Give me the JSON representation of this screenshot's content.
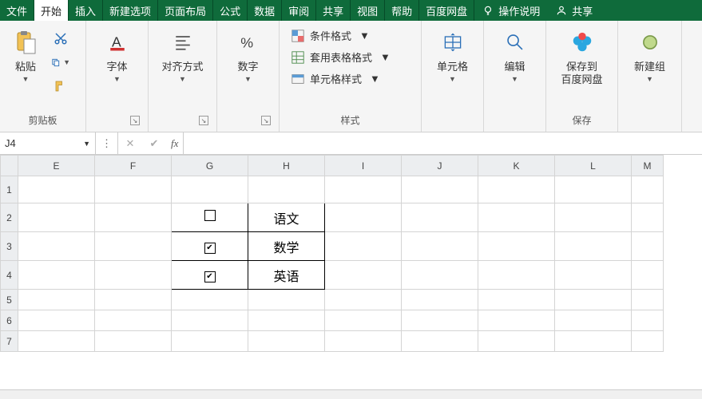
{
  "menu": {
    "items": [
      "文件",
      "开始",
      "插入",
      "新建选项",
      "页面布局",
      "公式",
      "数据",
      "审阅",
      "共享",
      "视图",
      "帮助",
      "百度网盘"
    ],
    "active_index": 1,
    "hint_label": "操作说明",
    "search_label": "共享"
  },
  "ribbon": {
    "clipboard": {
      "paste": "粘贴",
      "group": "剪贴板"
    },
    "font": {
      "label": "字体",
      "group": "字体"
    },
    "align": {
      "label": "对齐方式",
      "group": "对齐方式"
    },
    "number": {
      "label": "数字",
      "group": "数字"
    },
    "styles": {
      "cond": "条件格式",
      "table": "套用表格格式",
      "cell": "单元格样式",
      "group": "样式"
    },
    "cells": {
      "label": "单元格",
      "group": "单元格"
    },
    "editing": {
      "label": "编辑",
      "group": "编辑"
    },
    "baidu": {
      "save": "保存到\n百度网盘",
      "group": "保存"
    },
    "newgroup": {
      "label": "新建组"
    }
  },
  "formula_bar": {
    "namebox": "J4",
    "fx": "fx"
  },
  "grid": {
    "cols": [
      "E",
      "F",
      "G",
      "H",
      "I",
      "J",
      "K",
      "L",
      "M"
    ],
    "rows": [
      "1",
      "2",
      "3",
      "4",
      "5",
      "6",
      "7"
    ],
    "table": [
      {
        "checked": false,
        "label": "语文"
      },
      {
        "checked": true,
        "label": "数学"
      },
      {
        "checked": true,
        "label": "英语"
      }
    ]
  }
}
